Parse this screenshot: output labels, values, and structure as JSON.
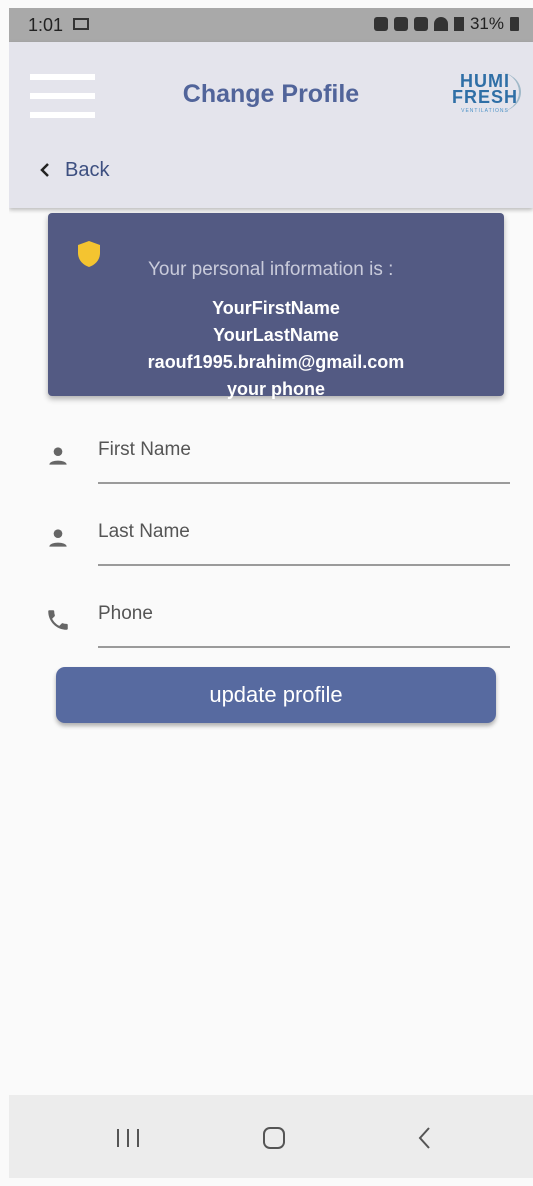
{
  "status_bar": {
    "time": "1:01",
    "battery": "31%"
  },
  "header": {
    "title": "Change Profile",
    "logo": {
      "line1": "HUMI",
      "line2": "FRESH",
      "line3": "VENTILATIONS"
    },
    "back_label": "Back"
  },
  "info_card": {
    "heading": "Your personal information is :",
    "first_name": "YourFirstName",
    "last_name": "YourLastName",
    "email": "raouf1995.brahim@gmail.com",
    "phone": "your phone",
    "shield_color": "#f4c430",
    "background": "#535a83"
  },
  "form": {
    "first_name_label": "First Name",
    "last_name_label": "Last Name",
    "phone_label": "Phone",
    "icons": [
      "person-icon",
      "person-icon",
      "phone-icon"
    ]
  },
  "actions": {
    "update_label": "update profile"
  },
  "colors": {
    "primary": "#576aa0",
    "title": "#51649a",
    "appbar": "#e4e4ec"
  }
}
